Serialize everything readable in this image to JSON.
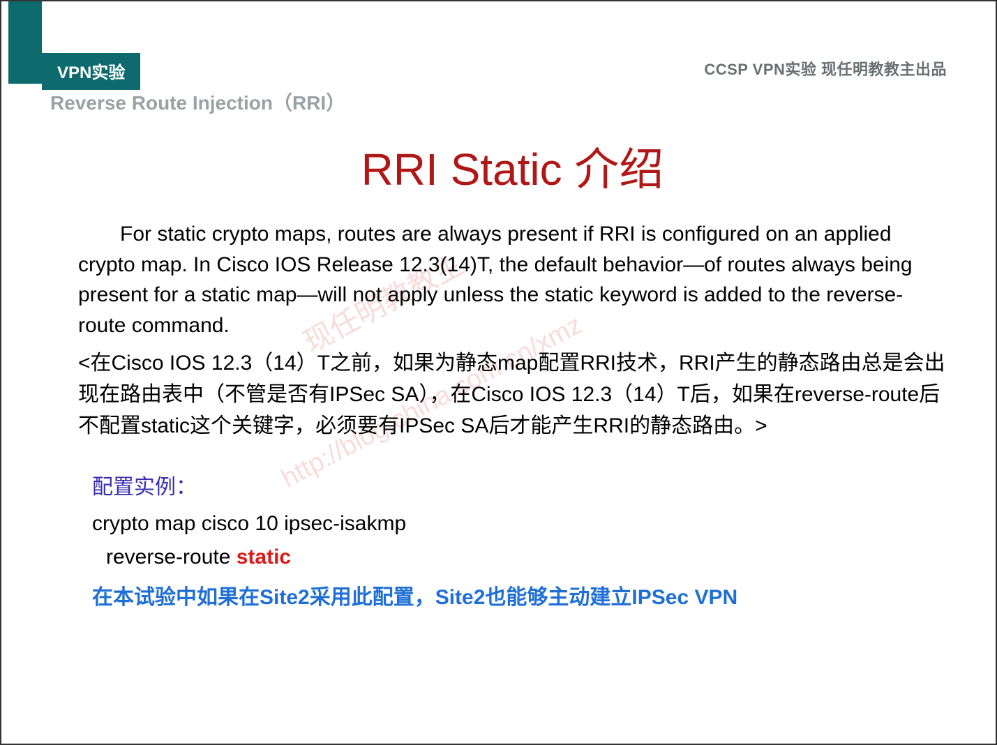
{
  "header": {
    "tab_label": "VPN实验",
    "top_right": "CCSP VPN实验 现任明教教主出品",
    "subtitle": "Reverse Route Injection（RRI）"
  },
  "title": "RRI Static 介绍",
  "paragraph_en": "For static crypto maps, routes are always present if RRI is configured on an applied crypto map. In Cisco IOS Release 12.3(14)T, the default behavior—of routes always being present for a static map—will not apply unless the static keyword is added to the reverse-route command.",
  "paragraph_cn": "<在Cisco IOS 12.3（14）T之前，如果为静态map配置RRI技术，RRI产生的静态路由总是会出现在路由表中（不管是否有IPSec SA），在Cisco IOS 12.3（14）T后，如果在reverse-route后不配置static这个关键字，必须要有IPSec SA后才能产生RRI的静态路由。>",
  "config": {
    "label": "配置实例：",
    "line1": "crypto map cisco 10 ipsec-isakmp",
    "line2_prefix": "reverse-route ",
    "line2_keyword": "static"
  },
  "note_cn": "在本试验中如果在Site2采用此配置，Site2也能够主动建立IPSec VPN",
  "watermark": {
    "line1": "现任明教教主",
    "line2": "http://blog.china.com.cn/xmz"
  }
}
